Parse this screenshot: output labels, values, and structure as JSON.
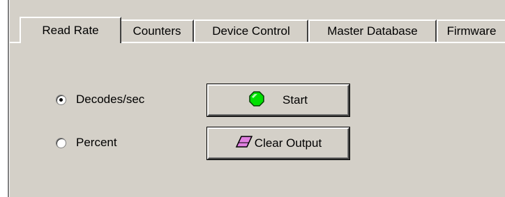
{
  "tabs": [
    {
      "label": "Read Rate",
      "active": true
    },
    {
      "label": "Counters",
      "active": false
    },
    {
      "label": "Device Control",
      "active": false
    },
    {
      "label": "Master Database",
      "active": false
    },
    {
      "label": "Firmware",
      "active": false
    }
  ],
  "mode_options": [
    {
      "label": "Decodes/sec",
      "selected": true
    },
    {
      "label": "Percent",
      "selected": false
    }
  ],
  "buttons": {
    "start": {
      "label": "Start",
      "icon": "green-octagon-icon",
      "icon_color": "#00e000"
    },
    "clear": {
      "label": "Clear Output",
      "icon": "eraser-icon",
      "icon_color": "#e080e0"
    }
  },
  "colors": {
    "panel": "#d4d0c8"
  }
}
